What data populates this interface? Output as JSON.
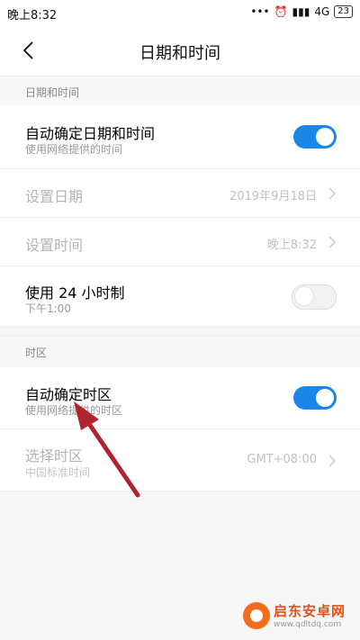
{
  "status_bar": {
    "time": "晚上8:32",
    "dots": "•••",
    "network": "4G",
    "battery": "23"
  },
  "header": {
    "title": "日期和时间"
  },
  "sections": {
    "datetime": "日期和时间",
    "timezone": "时区"
  },
  "rows": {
    "auto_datetime": {
      "title": "自动确定日期和时间",
      "subtitle": "使用网络提供的时间",
      "toggle": true
    },
    "set_date": {
      "title": "设置日期",
      "value": "2019年9月18日"
    },
    "set_time": {
      "title": "设置时间",
      "value": "晚上8:32"
    },
    "use_24h": {
      "title": "使用 24 小时制",
      "subtitle": "下午1:00",
      "toggle": false
    },
    "auto_timezone": {
      "title": "自动确定时区",
      "subtitle": "使用网络提供的时区",
      "toggle": true
    },
    "select_timezone": {
      "title": "选择时区",
      "subtitle": "中国标准时间",
      "value": "GMT+08:00"
    }
  },
  "watermark": {
    "main": "启东安卓网",
    "sub": "www.qdltdq.com"
  },
  "colors": {
    "accent": "#1a87e6",
    "arrow": "#b0252b"
  }
}
